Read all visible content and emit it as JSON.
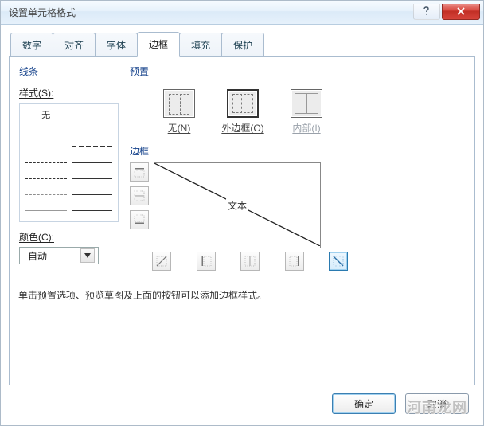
{
  "window": {
    "title": "设置单元格格式"
  },
  "tabs": [
    {
      "id": "number",
      "label": "数字"
    },
    {
      "id": "align",
      "label": "对齐"
    },
    {
      "id": "font",
      "label": "字体"
    },
    {
      "id": "border",
      "label": "边框",
      "active": true
    },
    {
      "id": "fill",
      "label": "填充"
    },
    {
      "id": "protect",
      "label": "保护"
    }
  ],
  "border_tab": {
    "lines": {
      "section": "线条",
      "style_label": "样式(S):",
      "none_swatch": "无",
      "color_label": "颜色(C):",
      "color_value": "自动"
    },
    "presets": {
      "section": "预置",
      "items": [
        {
          "id": "none",
          "label": "无(N)"
        },
        {
          "id": "outline",
          "label": "外边框(O)"
        },
        {
          "id": "inside",
          "label": "内部(I)",
          "disabled": true
        }
      ]
    },
    "border": {
      "section": "边框",
      "preview_text": "文本"
    },
    "hint": "单击预置选项、预览草图及上面的按钮可以添加边框样式。"
  },
  "footer": {
    "ok": "确定",
    "cancel": "取消"
  },
  "watermark": "河南龙网"
}
